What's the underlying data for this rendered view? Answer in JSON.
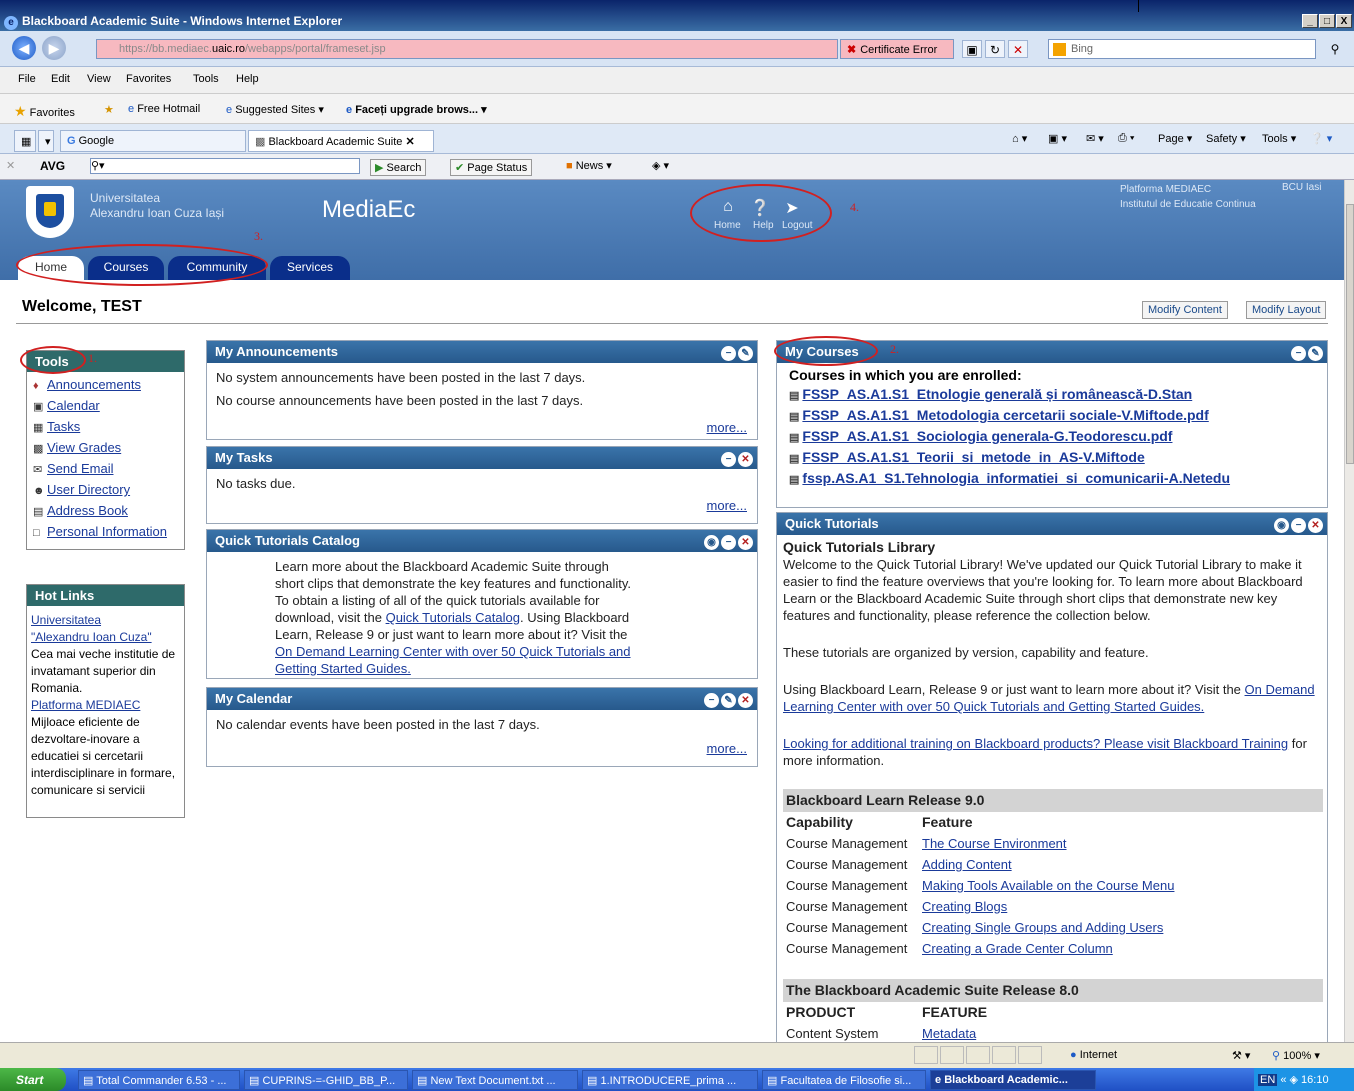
{
  "window": {
    "title": "Blackboard Academic Suite - Windows Internet Explorer",
    "controls": [
      "_",
      "□",
      "X"
    ]
  },
  "address": {
    "url_prefix": "https://bb.mediaec.",
    "url_domain": "uaic.ro",
    "url_path": "/webapps/portal/frameset.jsp",
    "cert_error": "Certificate Error",
    "search_placeholder": "Bing"
  },
  "menu": [
    "File",
    "Edit",
    "View",
    "Favorites",
    "Tools",
    "Help"
  ],
  "favorites": {
    "label": "Favorites",
    "items": [
      "Free Hotmail",
      "Suggested Sites ▾",
      "Faceți upgrade brows... ▾"
    ]
  },
  "tabs": {
    "google": "Google",
    "active": "Blackboard Academic Suite",
    "right": [
      "Page ▾",
      "Safety ▾",
      "Tools ▾"
    ]
  },
  "avg": {
    "logo": "AVG",
    "search": "Search",
    "page_status": "Page Status",
    "news": "News ▾"
  },
  "bb_header": {
    "uni_line1": "Universitatea",
    "uni_line2": "Alexandru Ioan Cuza Iași",
    "site": "MediaEc",
    "home": "Home",
    "help": "Help",
    "logout": "Logout",
    "platform_line1": "Platforma MEDIAEC",
    "platform_line2": "Institutul de Educatie Continua",
    "bcu": "BCU Iasi"
  },
  "annotations": {
    "n1": "1.",
    "n2": "2.",
    "n3": "3.",
    "n4": "4."
  },
  "main_tabs": [
    "Home",
    "Courses",
    "Community",
    "Services"
  ],
  "welcome": "Welcome, TEST",
  "modify_content": "Modify Content",
  "modify_layout": "Modify Layout",
  "tools": {
    "title": "Tools",
    "items": [
      "Announcements",
      "Calendar",
      "Tasks",
      "View Grades",
      "Send Email",
      "User Directory",
      "Address Book",
      "Personal Information"
    ]
  },
  "hot_links": {
    "title": "Hot Links",
    "link1a": "Universitatea",
    "link1b": "\"Alexandru Ioan Cuza\"",
    "text1": "Cea mai veche institutie de invatamant superior din Romania.",
    "link2": "Platforma MEDIAEC",
    "text2": "Mijloace eficiente de dezvoltare-inovare a educatiei si cercetarii interdisciplinare in formare, comunicare si servicii"
  },
  "announcements": {
    "title": "My Announcements",
    "line1": "No system announcements have been posted in the last 7 days.",
    "line2": "No course announcements have been posted in the last 7 days.",
    "more": "more..."
  },
  "tasks": {
    "title": "My Tasks",
    "line1": "No tasks due.",
    "more": "more..."
  },
  "catalog": {
    "title": "Quick Tutorials Catalog",
    "p1": "Learn more about the Blackboard Academic Suite through short clips that demonstrate the key features and functionality. To obtain a listing of all of the quick tutorials available for download, visit the",
    "link1": "Quick Tutorials Catalog",
    "p2": "Using Blackboard Learn, Release 9 or just want to learn more about it? Visit the",
    "link2": "On Demand Learning Center with over 50 Quick Tutorials and Getting Started Guides."
  },
  "calendar": {
    "title": "My Calendar",
    "line1": "No calendar events have been posted in the last 7 days.",
    "more": "more..."
  },
  "courses": {
    "title": "My Courses",
    "heading": "Courses in which you are enrolled:",
    "items": [
      "FSSP_AS.A1.S1_Etnologie generală și românească-D.Stan",
      "FSSP_AS.A1.S1_Metodologia cercetarii sociale-V.Miftode.pdf",
      "FSSP_AS.A1.S1_Sociologia generala-G.Teodorescu.pdf",
      "FSSP_AS.A1.S1_Teorii_si_metode_in_AS-V.Miftode",
      "fssp.AS.A1_S1.Tehnologia_informatiei_si_comunicarii-A.Netedu"
    ]
  },
  "quick": {
    "title": "Quick Tutorials",
    "lib_title": "Quick Tutorials Library",
    "p1": "Welcome to the Quick Tutorial Library! We've updated our Quick Tutorial Library to make it easier to find the feature overviews that you're looking for. To learn more about Blackboard Learn or the Blackboard Academic Suite through short clips that demonstrate new key features and functionality, please reference the collection below.",
    "p2": "These tutorials are organized by version, capability and feature.",
    "p3": "Using Blackboard Learn, Release 9 or just want to learn more about it? Visit the",
    "p3_link": "On Demand Learning Center with over 50 Quick Tutorials and Getting Started Guides.",
    "p4_link": "Looking for additional training on Blackboard products? Please visit Blackboard Training",
    "p4": "for more information.",
    "group1": "Blackboard Learn Release 9.0",
    "col1": "Capability",
    "col2": "Feature",
    "rows": [
      {
        "cap": "Course Management",
        "feat": "The Course Environment"
      },
      {
        "cap": "Course Management",
        "feat": "Adding Content"
      },
      {
        "cap": "Course Management",
        "feat": "Making Tools Available on the Course Menu"
      },
      {
        "cap": "Course Management",
        "feat": "Creating Blogs"
      },
      {
        "cap": "Course Management",
        "feat": "Creating Single Groups and Adding Users"
      },
      {
        "cap": "Course Management",
        "feat": "Creating a Grade Center Column"
      }
    ],
    "group2": "The Blackboard Academic Suite Release 8.0",
    "col3": "PRODUCT",
    "col4": "FEATURE",
    "row2_cap": "Content System",
    "row2_feat": "Metadata"
  },
  "status": {
    "zone": "Internet",
    "zoom": "100%"
  },
  "taskbar": {
    "start": "Start",
    "items": [
      "Total Commander 6.53 - ...",
      "CUPRINS-=-GHID_BB_P...",
      "New Text Document.txt ...",
      "1.INTRODUCERE_prima ...",
      "Facultatea de Filosofie si...",
      "Blackboard Academic..."
    ],
    "lang": "EN",
    "clock": "16:10"
  }
}
